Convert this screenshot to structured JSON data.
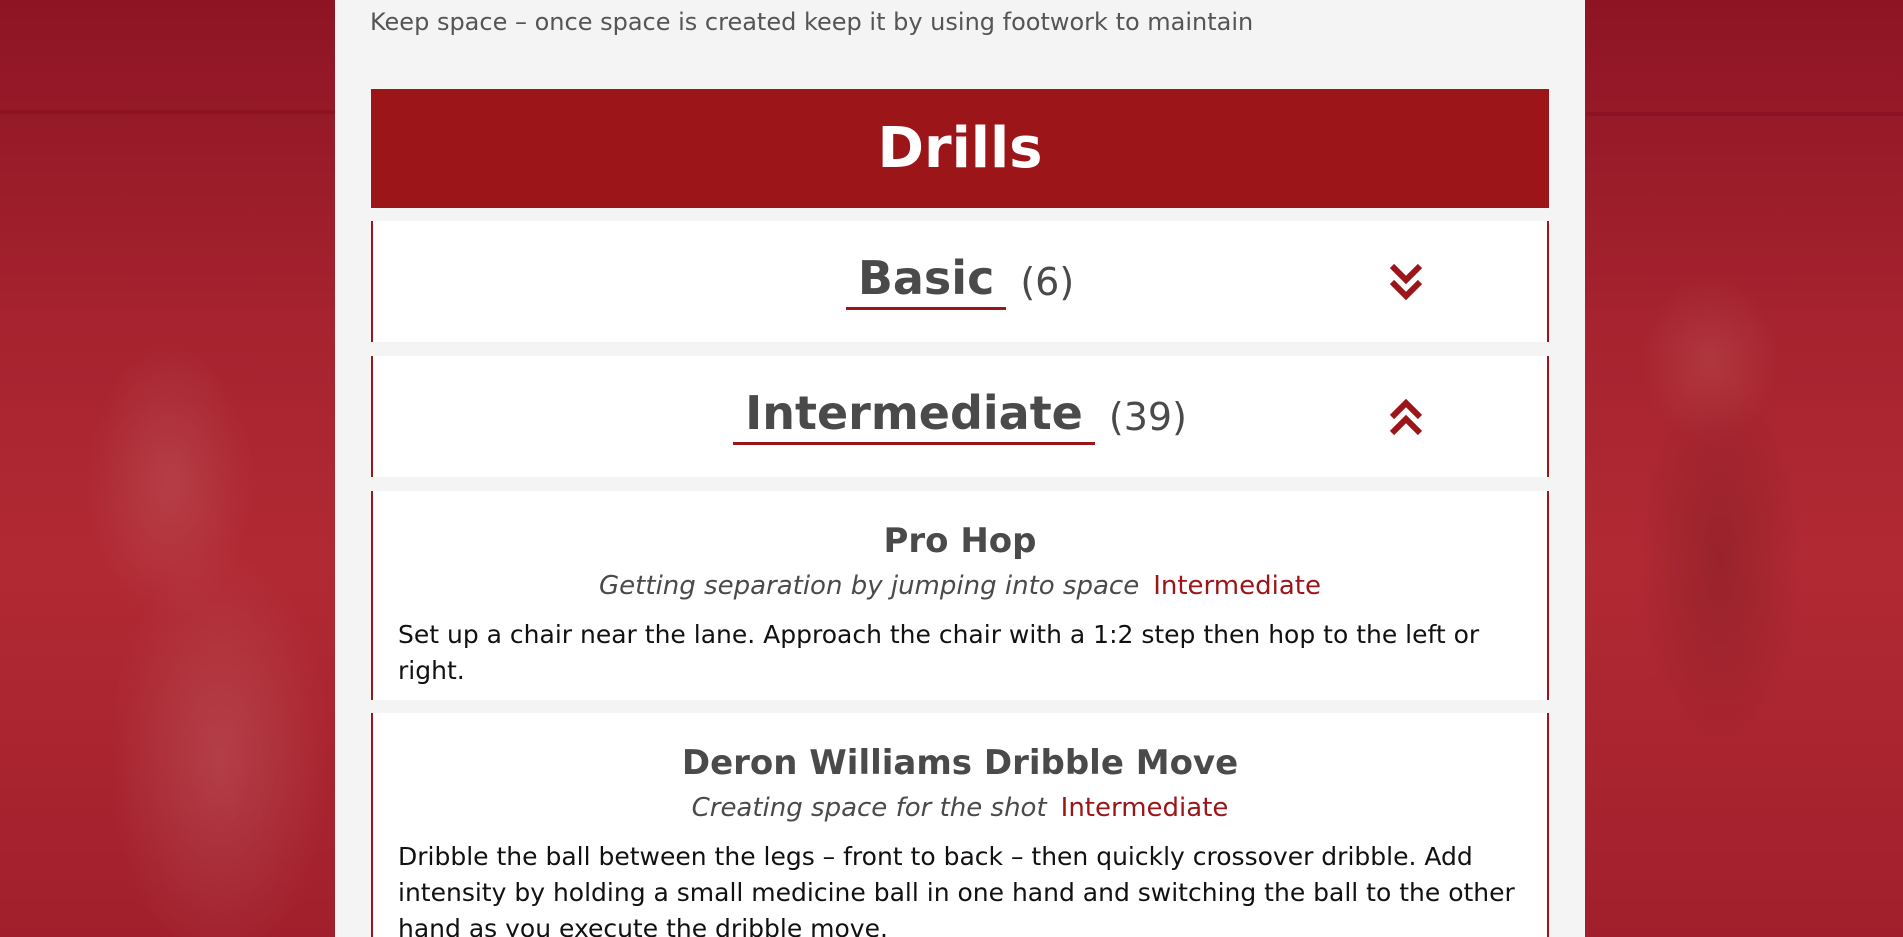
{
  "intro_text": "Keep space – once space is created keep it by using footwork to maintain",
  "section_title": "Drills",
  "categories": [
    {
      "name": "Basic",
      "count": "(6)",
      "chevron": "double-chevron-down-icon"
    },
    {
      "name": "Intermediate",
      "count": "(39)",
      "chevron": "double-chevron-up-icon"
    }
  ],
  "drills": [
    {
      "title": "Pro Hop",
      "tagline": "Getting separation by jumping into space",
      "level": "Intermediate",
      "description": "Set up a chair near the lane. Approach the chair with a 1:2 step then hop to the left or right."
    },
    {
      "title": "Deron Williams Dribble Move",
      "tagline": "Creating space for the shot",
      "level": "Intermediate",
      "description": "Dribble the ball between the legs – front to back – then quickly crossover dribble. Add intensity by holding a small medicine ball in one hand and switching the ball to the other hand as you execute the dribble move."
    }
  ],
  "colors": {
    "accent": "#9c1519",
    "panel_bg": "#ffffff",
    "page_bg": "#f4f4f4"
  }
}
